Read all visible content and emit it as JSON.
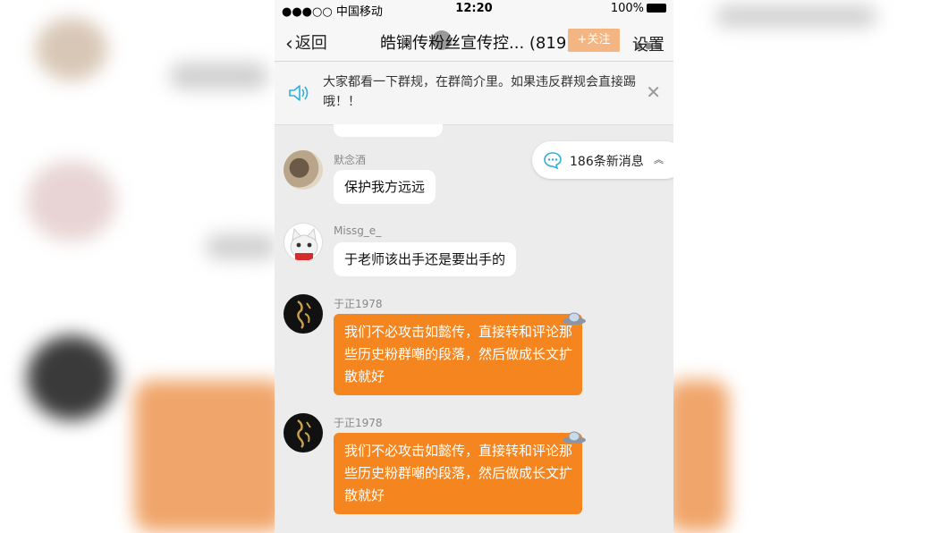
{
  "status_bar": {
    "carrier": "●●●○○ 中国移动",
    "time": "12:20",
    "battery": "100%"
  },
  "navbar": {
    "back_label": "返回",
    "title": "皓镧传粉丝宣传控... (819)",
    "follow_label": "+关注",
    "settings_label": "设置"
  },
  "notice": {
    "text": "大家都看一下群规，在群简介里。如果违反群规会直接踢哦！！",
    "close": "✕"
  },
  "partial_bubble_text": "保护我方远远",
  "new_messages": {
    "label": "186条新消息"
  },
  "messages": [
    {
      "sender": "默念酒",
      "text": "保护我方远远",
      "style": "white",
      "avatar": "photo-avatar"
    },
    {
      "sender": "Missg_e_",
      "text": "于老师该出手还是要出手的",
      "style": "white",
      "avatar": "cat-avatar"
    },
    {
      "sender": "于正1978",
      "text": "我们不必攻击如懿传，直接转和评论那些历史粉群嘲的段落，然后做成长文扩散就好",
      "style": "orange",
      "avatar": "calligraphy-avatar"
    },
    {
      "sender": "于正1978",
      "text": "我们不必攻击如懿传，直接转和评论那些历史粉群嘲的段落，然后做成长文扩散就好",
      "style": "orange",
      "avatar": "calligraphy-avatar"
    }
  ],
  "colors": {
    "orange_bubble": "#f5861f",
    "chat_background": "#ececec",
    "new_message_icon": "#2fb0d6"
  }
}
